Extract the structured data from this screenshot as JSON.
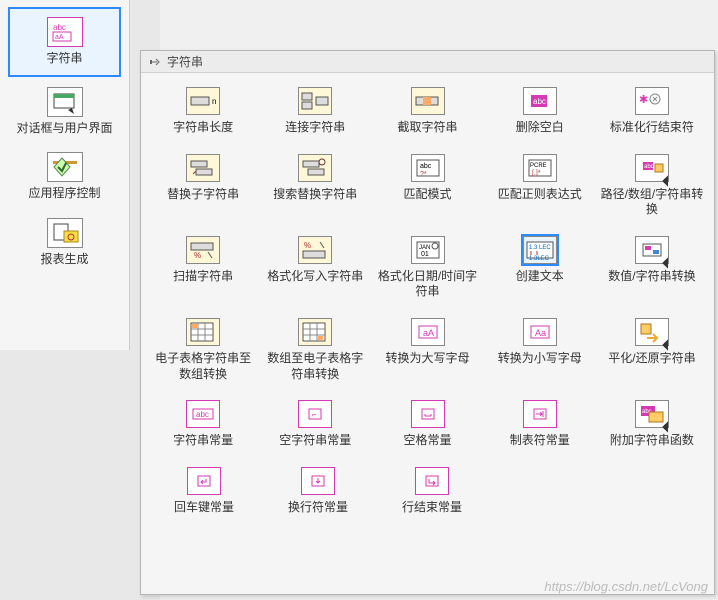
{
  "sidebar": {
    "items": [
      {
        "label": "字符串",
        "icon": "abc"
      },
      {
        "label": "对话框与用户界面",
        "icon": "dlg"
      },
      {
        "label": "应用程序控制",
        "icon": "app"
      },
      {
        "label": "报表生成",
        "icon": "rpt"
      }
    ]
  },
  "flyout": {
    "title": "字符串",
    "rows": [
      [
        {
          "label": "字符串长度",
          "icon": "len"
        },
        {
          "label": "连接字符串",
          "icon": "cat"
        },
        {
          "label": "截取字符串",
          "icon": "sub"
        },
        {
          "label": "删除空白",
          "icon": "trim"
        },
        {
          "label": "标准化行结束符",
          "icon": "norm"
        }
      ],
      [
        {
          "label": "替换子字符串",
          "icon": "rep"
        },
        {
          "label": "搜索替换字符串",
          "icon": "srep"
        },
        {
          "label": "匹配模式",
          "icon": "mpat"
        },
        {
          "label": "匹配正则表达式",
          "icon": "regex"
        },
        {
          "label": "路径/数组/字符串转换",
          "icon": "path",
          "tri": true
        }
      ],
      [
        {
          "label": "扫描字符串",
          "icon": "scan"
        },
        {
          "label": "格式化写入字符串",
          "icon": "fmt"
        },
        {
          "label": "格式化日期/时间字符串",
          "icon": "date"
        },
        {
          "label": "创建文本",
          "icon": "build",
          "hl": true
        },
        {
          "label": "数值/字符串转换",
          "icon": "num",
          "tri": true
        }
      ],
      [
        {
          "label": "电子表格字符串至数组转换",
          "icon": "ss2a"
        },
        {
          "label": "数组至电子表格字符串转换",
          "icon": "a2ss"
        },
        {
          "label": "转换为大写字母",
          "icon": "upper"
        },
        {
          "label": "转换为小写字母",
          "icon": "lower"
        },
        {
          "label": "平化/还原字符串",
          "icon": "flat",
          "tri": true
        }
      ],
      [
        {
          "label": "字符串常量",
          "icon": "sconst",
          "pink": true
        },
        {
          "label": "空字符串常量",
          "icon": "empty",
          "pink": true
        },
        {
          "label": "空格常量",
          "icon": "space",
          "pink": true
        },
        {
          "label": "制表符常量",
          "icon": "tab",
          "pink": true
        },
        {
          "label": "附加字符串函数",
          "icon": "more",
          "tri": true
        }
      ],
      [
        {
          "label": "回车键常量",
          "icon": "cr",
          "pink": true
        },
        {
          "label": "换行符常量",
          "icon": "lf",
          "pink": true
        },
        {
          "label": "行结束常量",
          "icon": "eol",
          "pink": true
        }
      ]
    ]
  },
  "watermark": "https://blog.csdn.net/LcVong"
}
